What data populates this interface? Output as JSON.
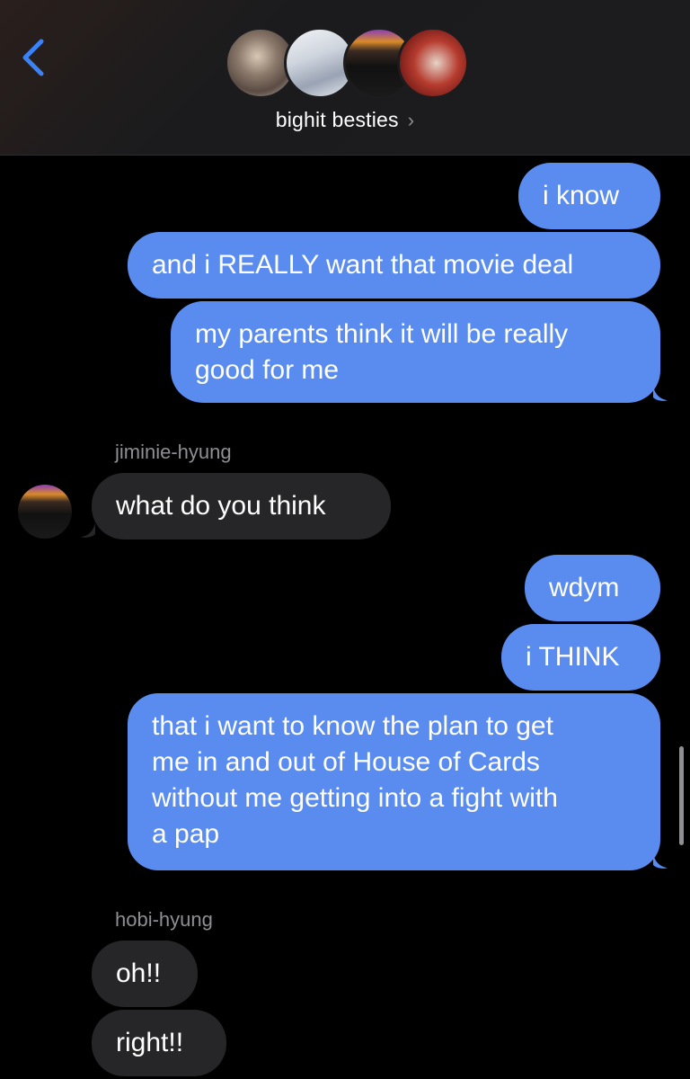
{
  "header": {
    "group_name": "bighit besties",
    "chevron": "›",
    "back_icon": "chevron-left-icon",
    "accent_color": "#3b82f6"
  },
  "messages": {
    "m1": "i know",
    "m2": "and i REALLY want that movie deal",
    "m3_line1": "my parents think it will be really",
    "m3_line2": "good for me",
    "sender1": "jiminie-hyung",
    "m4": "what do you think",
    "m5": "wdym",
    "m6": "i THINK",
    "m7_line1": "that i want to know the plan to get",
    "m7_line2": "me in and out of House of Cards",
    "m7_line3": "without me getting into a fight with",
    "m7_line4": "a pap",
    "sender2": "hobi-hyung",
    "m8": "oh!!",
    "m9": "right!!"
  },
  "colors": {
    "outgoing_bubble": "#5a8cf0",
    "incoming_bubble": "#262628",
    "background": "#000000"
  }
}
